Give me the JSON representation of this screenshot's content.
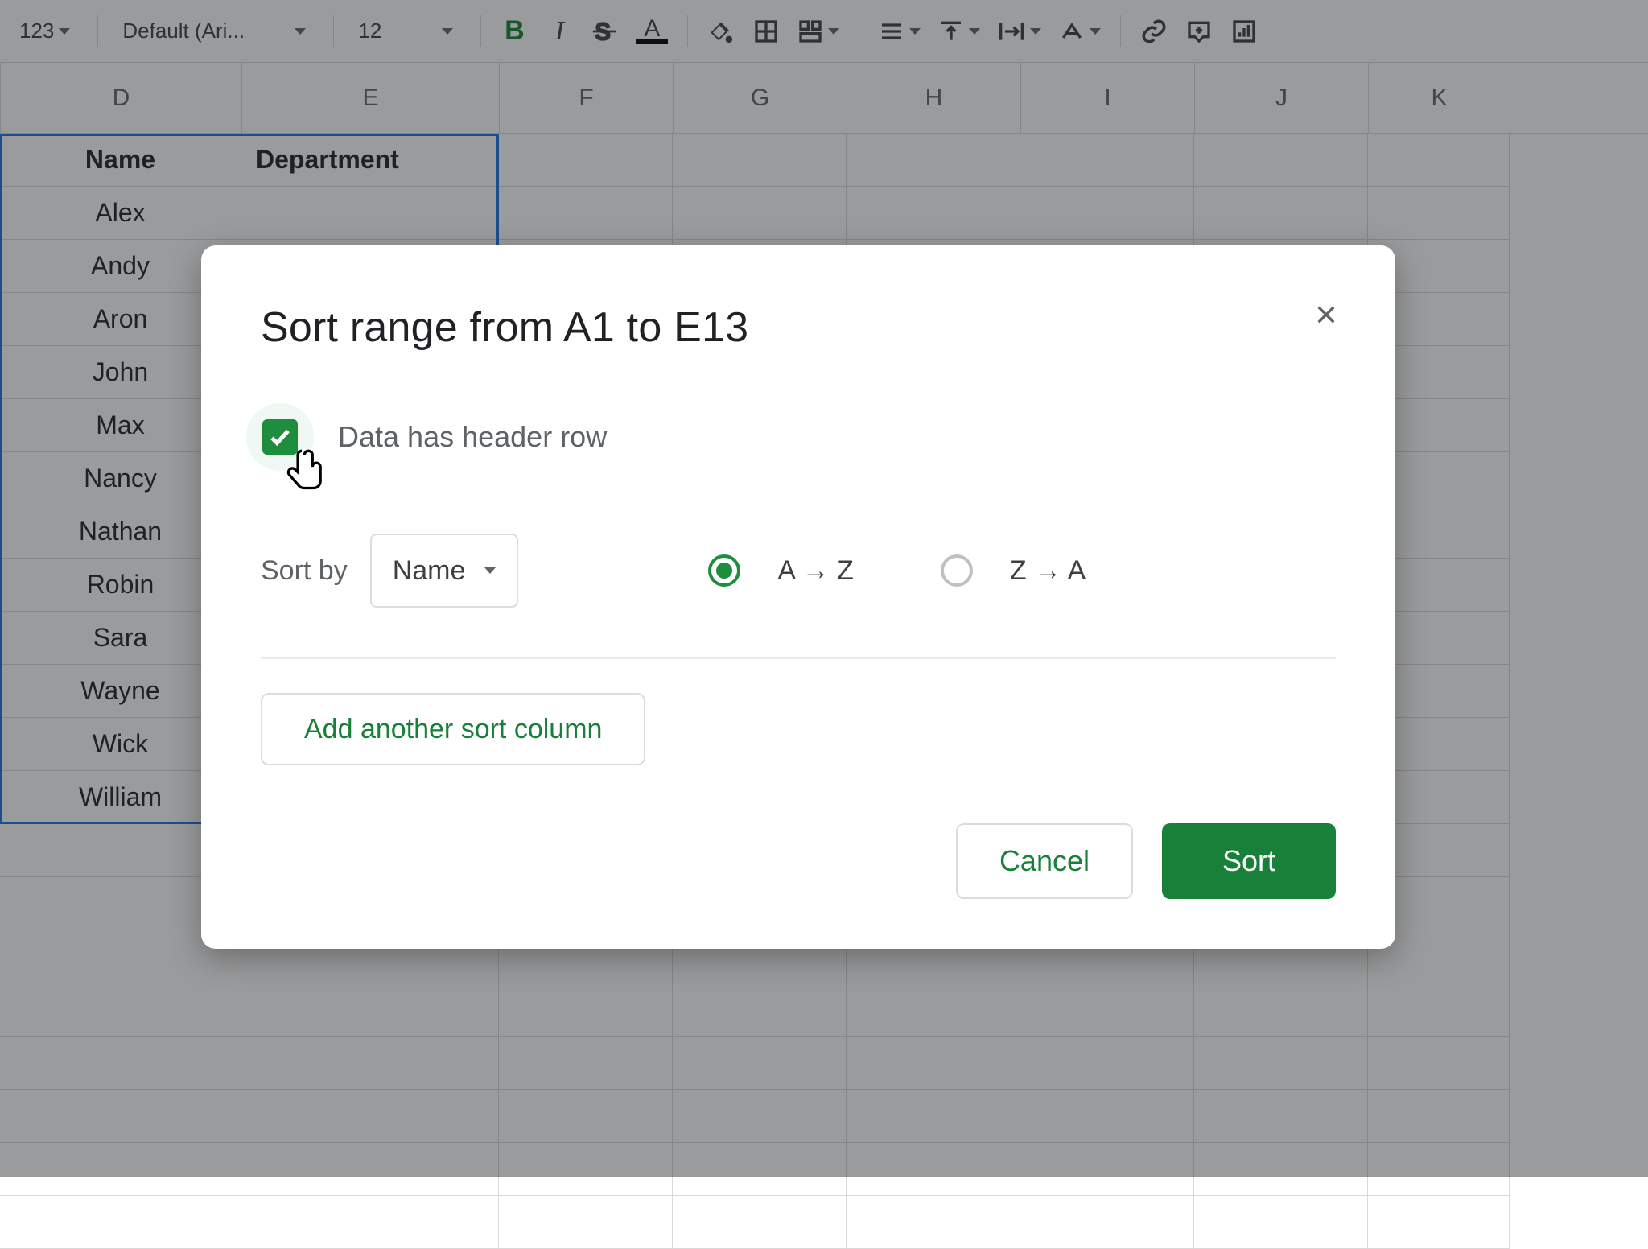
{
  "toolbar": {
    "number_format": "123",
    "font_name": "Default (Ari...",
    "font_size": "12"
  },
  "columns": [
    "D",
    "E",
    "F",
    "G",
    "H",
    "I",
    "J",
    "K"
  ],
  "headers": {
    "D": "Name",
    "E": "Department"
  },
  "rows": [
    "Alex",
    "Andy",
    "Aron",
    "John",
    "Max",
    "Nancy",
    "Nathan",
    "Robin",
    "Sara",
    "Wayne",
    "Wick",
    "William"
  ],
  "dialog": {
    "title": "Sort range from A1 to E13",
    "header_checkbox_label": "Data has header row",
    "sort_by_label": "Sort by",
    "sort_by_value": "Name",
    "radio_az": "A → Z",
    "radio_za": "Z → A",
    "add_column": "Add another sort column",
    "cancel": "Cancel",
    "sort": "Sort"
  }
}
